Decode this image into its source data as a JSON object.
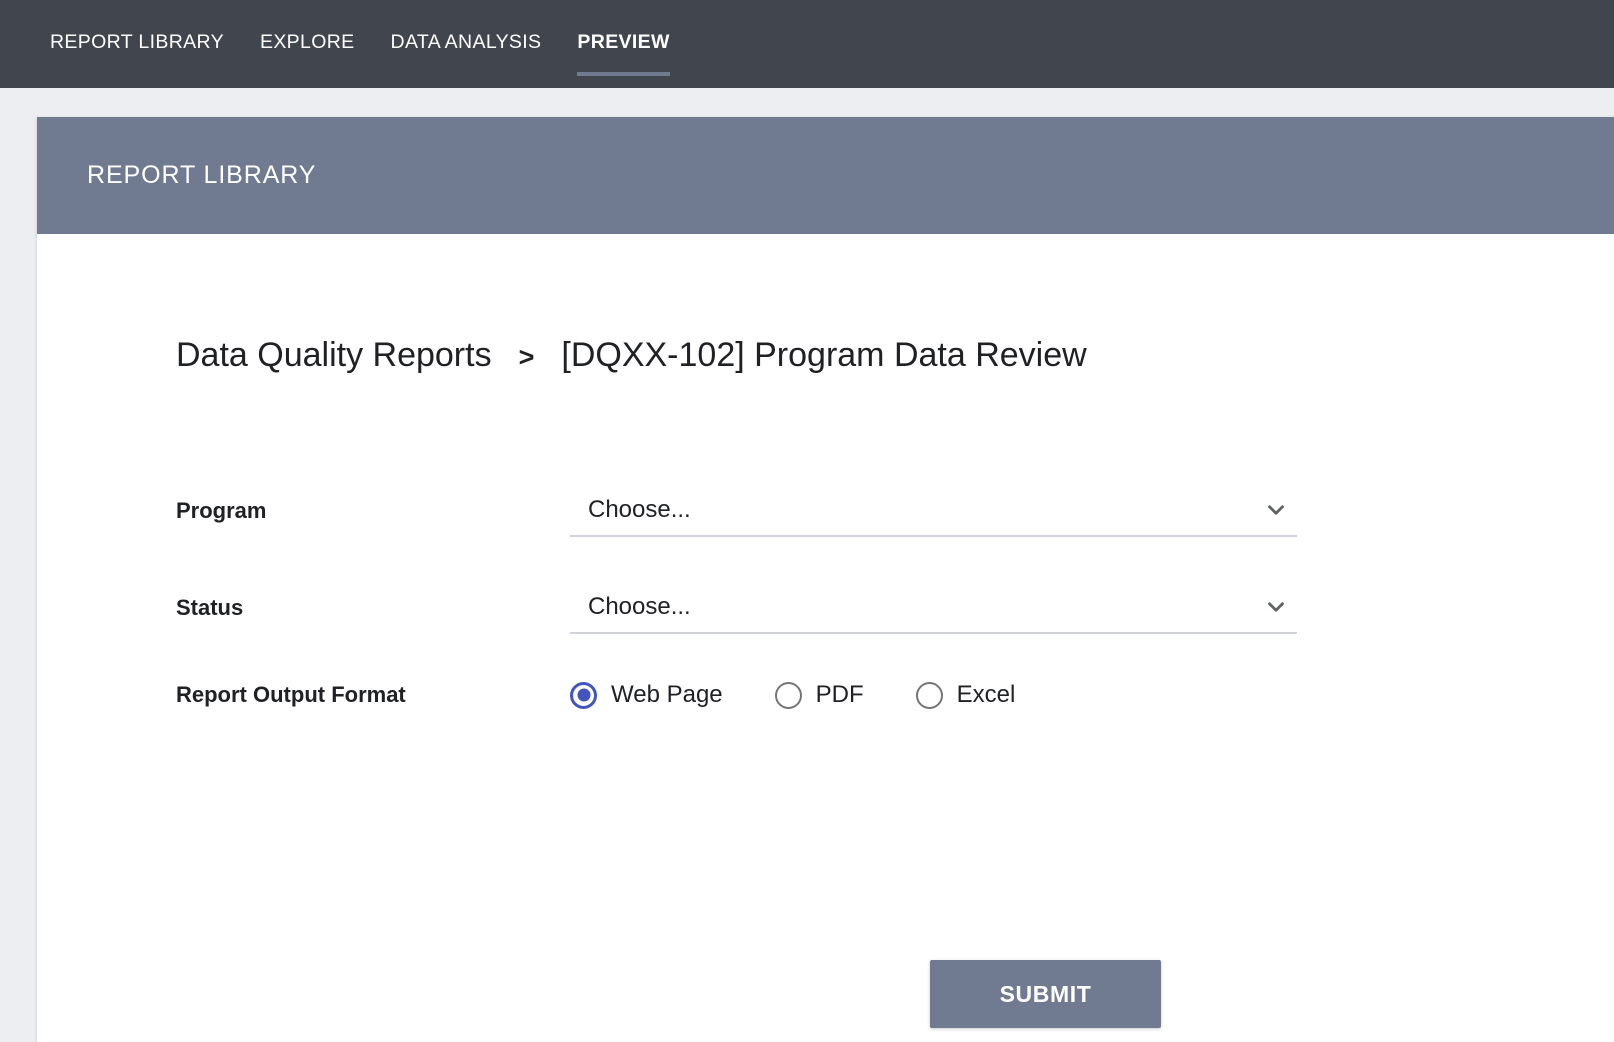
{
  "topnav": {
    "background_color": "#41454e",
    "accent_color": "#707b91",
    "items": [
      {
        "label": "REPORT LIBRARY",
        "active": false
      },
      {
        "label": "EXPLORE",
        "active": false
      },
      {
        "label": "DATA ANALYSIS",
        "active": false
      },
      {
        "label": "PREVIEW",
        "active": true
      }
    ]
  },
  "card": {
    "header_title": "REPORT LIBRARY",
    "header_color": "#707b91"
  },
  "breadcrumb": {
    "root": "Data Quality Reports",
    "separator": ">",
    "current": "[DQXX-102] Program Data Review"
  },
  "form": {
    "program": {
      "label": "Program",
      "value": "Choose...",
      "icon": "chevron-down-icon"
    },
    "status": {
      "label": "Status",
      "value": "Choose...",
      "icon": "chevron-down-icon"
    },
    "output_format": {
      "label": "Report Output Format",
      "selected": "Web Page",
      "selected_color": "#4355bd",
      "options": [
        {
          "label": "Web Page",
          "selected": true
        },
        {
          "label": "PDF",
          "selected": false
        },
        {
          "label": "Excel",
          "selected": false
        }
      ]
    },
    "submit": {
      "label": "SUBMIT",
      "color": "#707b91"
    }
  }
}
